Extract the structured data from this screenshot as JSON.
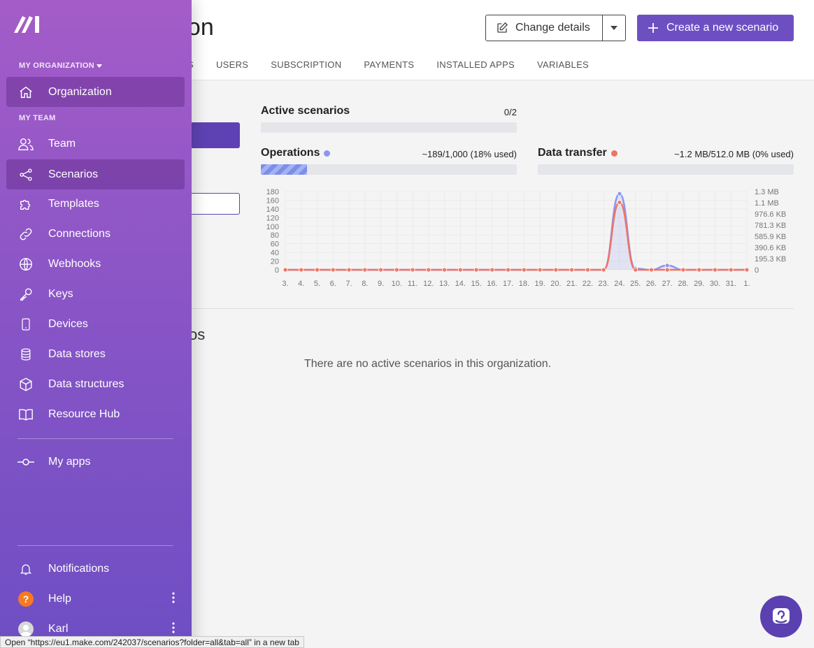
{
  "header": {
    "title_partial": "zation",
    "change_details_label": "Change details",
    "create_label": "Create a new scenario",
    "tabs": [
      "S",
      "USERS",
      "SUBSCRIPTION",
      "PAYMENTS",
      "INSTALLED APPS",
      "VARIABLES"
    ]
  },
  "stats": {
    "active": {
      "title": "Active scenarios",
      "value": "0/2",
      "fraction": 0
    },
    "operations": {
      "title": "Operations",
      "value": "~189/1,000 (18% used)",
      "fraction": 0.18,
      "color": "#8b96f0"
    },
    "data_transfer": {
      "title": "Data transfer",
      "value": "~1.2 MB/512.0 MB (0% used)",
      "fraction": 0,
      "color": "#f07464"
    }
  },
  "main": {
    "section_heading_partial": "os",
    "empty_message": "There are no active scenarios in this organization."
  },
  "chart_data": {
    "type": "line",
    "x": [
      "3.",
      "4.",
      "5.",
      "6.",
      "7.",
      "8.",
      "9.",
      "10.",
      "11.",
      "12.",
      "13.",
      "14.",
      "15.",
      "16.",
      "17.",
      "18.",
      "19.",
      "20.",
      "21.",
      "22.",
      "23.",
      "24.",
      "25.",
      "26.",
      "27.",
      "28.",
      "29.",
      "30.",
      "31.",
      "1."
    ],
    "left_ticks": [
      "180",
      "160",
      "140",
      "120",
      "100",
      "80",
      "60",
      "40",
      "20",
      "0"
    ],
    "right_ticks": [
      "1.3 MB",
      "1.1 MB",
      "976.6 KB",
      "781.3 KB",
      "585.9 KB",
      "390.6 KB",
      "195.3 KB",
      "0"
    ],
    "ylim": [
      0,
      180
    ],
    "series": [
      {
        "name": "Operations",
        "color": "#8b96f0",
        "values": [
          0,
          0,
          0,
          0,
          0,
          0,
          0,
          0,
          0,
          0,
          0,
          0,
          0,
          0,
          0,
          0,
          0,
          0,
          0,
          0,
          0,
          175,
          3,
          0,
          10,
          0,
          0,
          0,
          0,
          0
        ]
      },
      {
        "name": "Data transfer",
        "color": "#f07464",
        "values": [
          0,
          0,
          0,
          0,
          0,
          0,
          0,
          0,
          0,
          0,
          0,
          0,
          0,
          0,
          0,
          0,
          0,
          0,
          0,
          0,
          0,
          155,
          0,
          0,
          0,
          0,
          0,
          0,
          0,
          0
        ]
      }
    ],
    "grid": true
  },
  "sidebar": {
    "org_label": "MY ORGANIZATION",
    "team_label": "MY TEAM",
    "organization": "Organization",
    "items": [
      {
        "label": "Team",
        "icon": "team-icon"
      },
      {
        "label": "Scenarios",
        "icon": "scenarios-icon"
      },
      {
        "label": "Templates",
        "icon": "puzzle-icon"
      },
      {
        "label": "Connections",
        "icon": "link-icon"
      },
      {
        "label": "Webhooks",
        "icon": "globe-icon"
      },
      {
        "label": "Keys",
        "icon": "key-icon"
      },
      {
        "label": "Devices",
        "icon": "phone-icon"
      },
      {
        "label": "Data stores",
        "icon": "database-icon"
      },
      {
        "label": "Data structures",
        "icon": "cube-icon"
      },
      {
        "label": "Resource Hub",
        "icon": "book-icon"
      }
    ],
    "my_apps": "My apps",
    "notifications": "Notifications",
    "help": "Help",
    "user": "Karl"
  },
  "status_bar": "Open “https://eu1.make.com/242037/scenarios?folder=all&tab=all” in a new tab"
}
